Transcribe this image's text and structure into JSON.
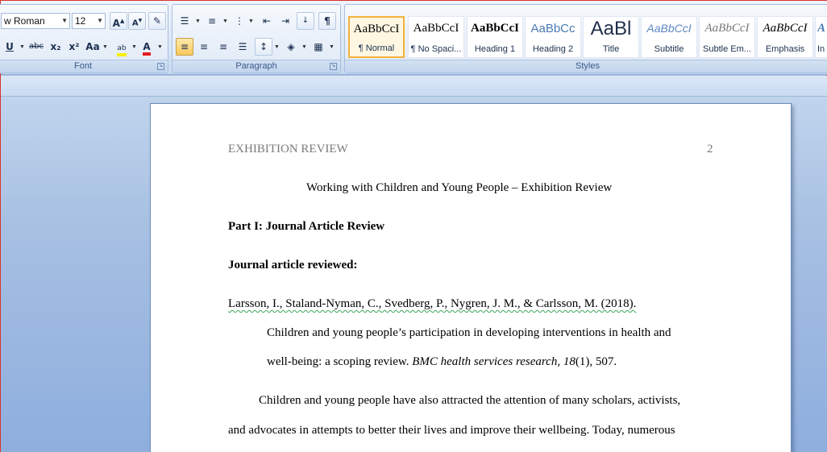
{
  "font_group": {
    "label": "Font",
    "font_name": "w Roman",
    "font_size": "12",
    "underline_icon": "underline-icon",
    "strikethrough_label": "abc",
    "subscript_label": "x₂",
    "superscript_label": "x²",
    "change_case_label": "Aa"
  },
  "paragraph_group": {
    "label": "Paragraph"
  },
  "styles_group": {
    "label": "Styles",
    "tiles": [
      {
        "sample": "AaBbCcI",
        "name": "¶ Normal"
      },
      {
        "sample": "AaBbCcI",
        "name": "¶ No Spaci..."
      },
      {
        "sample": "AaBbCcI",
        "name": "Heading 1"
      },
      {
        "sample": "AaBbCc",
        "name": "Heading 2"
      },
      {
        "sample": "AaBl",
        "name": "Title"
      },
      {
        "sample": "AaBbCcI",
        "name": "Subtitle"
      },
      {
        "sample": "AaBbCcI",
        "name": "Subtle Em..."
      },
      {
        "sample": "AaBbCcI",
        "name": "Emphasis"
      },
      {
        "sample": "A",
        "name": "In"
      }
    ]
  },
  "document": {
    "running_head": "EXHIBITION REVIEW",
    "page_number": "2",
    "title": "Working with Children and Young People – Exhibition Review",
    "part_heading": "Part I: Journal Article Review",
    "reviewed_label": "Journal article reviewed:",
    "citation_line1": "Larsson, I., Staland-Nyman, C., Svedberg, P., Nygren, J. M., & Carlsson, M. (2018).",
    "citation_line2": "Children and young people’s participation in developing interventions in health and",
    "citation_line3_a": "well-being: a scoping review. ",
    "citation_line3_journal": "BMC health services research, 18",
    "citation_line3_b": "(1), 507.",
    "body_line1": "Children and young people have also attracted the attention of many scholars, activists,",
    "body_line2": "and advocates in attempts to better their lives and improve their wellbeing. Today, numerous"
  }
}
